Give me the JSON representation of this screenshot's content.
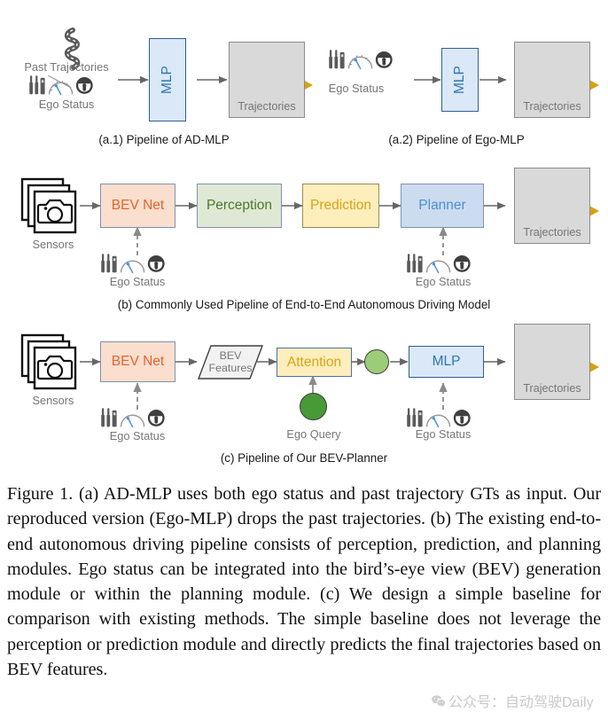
{
  "figure": {
    "panels": [
      {
        "id": "a1",
        "subcaption": "(a.1) Pipeline of AD-MLP",
        "inputs": [
          {
            "name": "past-trajectories",
            "label": "Past Trajectories",
            "icon": "winding-road-icon"
          },
          {
            "name": "ego-status",
            "label": "Ego Status",
            "icon": "ego-status-icon"
          }
        ],
        "blocks": [
          {
            "name": "mlp",
            "label": "MLP",
            "color": "#dbe8f7",
            "text_color": "#2e74b5"
          }
        ],
        "output": {
          "name": "trajectories",
          "label": "Trajectories"
        }
      },
      {
        "id": "a2",
        "subcaption": "(a.2) Pipeline of Ego-MLP",
        "inputs": [
          {
            "name": "ego-status",
            "label": "Ego Status",
            "icon": "ego-status-icon"
          }
        ],
        "blocks": [
          {
            "name": "mlp",
            "label": "MLP",
            "color": "#dbe8f7",
            "text_color": "#2e74b5"
          }
        ],
        "output": {
          "name": "trajectories",
          "label": "Trajectories"
        }
      },
      {
        "id": "b",
        "subcaption": "(b) Commonly Used Pipeline of End-to-End Autonomous Driving Model",
        "inputs": [
          {
            "name": "sensors",
            "label": "Sensors",
            "icon": "camera-stack-icon"
          },
          {
            "name": "ego-status-bev",
            "label": "Ego Status",
            "icon": "ego-status-icon"
          },
          {
            "name": "ego-status-planner",
            "label": "Ego Status",
            "icon": "ego-status-icon"
          }
        ],
        "blocks": [
          {
            "name": "bev-net",
            "label": "BEV Net",
            "color": "#fbdfce",
            "text_color": "#e8622a"
          },
          {
            "name": "perception",
            "label": "Perception",
            "color": "#dfe8d4",
            "text_color": "#4a7a2a"
          },
          {
            "name": "prediction",
            "label": "Prediction",
            "color": "#fdeebc",
            "text_color": "#d9a315"
          },
          {
            "name": "planner",
            "label": "Planner",
            "color": "#ccdcf0",
            "text_color": "#4a8fd4"
          }
        ],
        "output": {
          "name": "trajectories",
          "label": "Trajectories"
        }
      },
      {
        "id": "c",
        "subcaption": "(c) Pipeline of Our BEV-Planner",
        "inputs": [
          {
            "name": "sensors",
            "label": "Sensors",
            "icon": "camera-stack-icon"
          },
          {
            "name": "ego-status-bev",
            "label": "Ego Status",
            "icon": "ego-status-icon"
          },
          {
            "name": "ego-query",
            "label": "Ego Query",
            "icon": "green-circle-icon"
          },
          {
            "name": "ego-status-mlp",
            "label": "Ego Status",
            "icon": "ego-status-icon"
          }
        ],
        "blocks": [
          {
            "name": "bev-net",
            "label": "BEV Net",
            "color": "#fbdfce",
            "text_color": "#e8622a"
          },
          {
            "name": "bev-features",
            "label": "BEV\nFeatures",
            "line1": "BEV",
            "line2": "Features",
            "color": "#f2f2f2",
            "text_color": "#767676"
          },
          {
            "name": "attention",
            "label": "Attention",
            "color": "#fdeebc",
            "text_color": "#d9a315"
          },
          {
            "name": "mlp",
            "label": "MLP",
            "color": "#dbe8f7",
            "text_color": "#2e74b5"
          }
        ],
        "output": {
          "name": "trajectories",
          "label": "Trajectories"
        }
      }
    ],
    "colors": {
      "mlp_fill": "#dbe8f7",
      "bev_fill": "#fbdfce",
      "perception_fill": "#dfe8d4",
      "prediction_fill": "#fdeebc",
      "planner_fill": "#ccdcf0",
      "traj_box_fill": "#d9d9d9",
      "green_light": "#9ccc77",
      "green_dark": "#479a35",
      "arrow_green": "#3d8b37",
      "arrow_orange": "#d6a113",
      "car_red": "#e04848",
      "label_gray": "#767676"
    }
  },
  "caption": {
    "text": "Figure 1. (a) AD-MLP uses both ego status and past trajectory GTs as input. Our reproduced version (Ego-MLP) drops the past trajectories. (b) The existing end-to-end autonomous driving pipeline consists of perception, prediction, and planning modules. Ego status can be integrated into the bird’s-eye view (BEV) generation module or within the planning module. (c) We design a simple baseline for comparison with existing methods. The simple baseline does not leverage the perception or prediction module and directly predicts the final trajectories based on BEV features."
  },
  "watermark": {
    "text": "公众号：自动驾驶Daily",
    "icon": "wechat-icon"
  }
}
